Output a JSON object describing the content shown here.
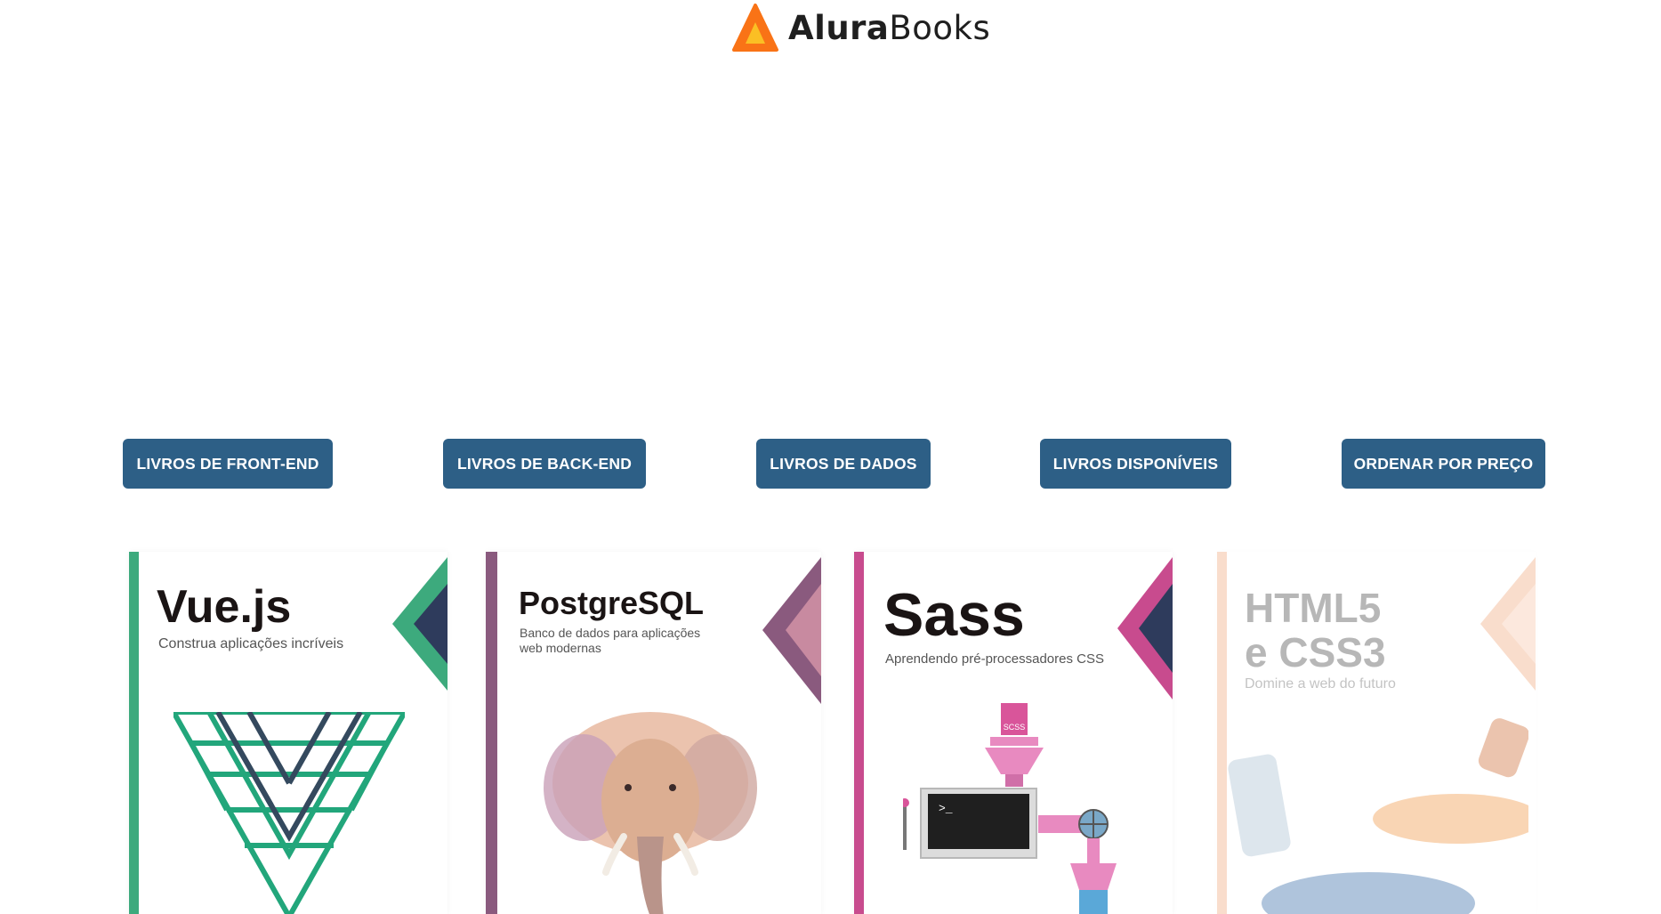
{
  "header": {
    "logo_bold": "Alura",
    "logo_regular": "Books",
    "logo_icon": "triangle-logo-icon"
  },
  "filters": [
    {
      "label": "LIVROS DE FRONT-END"
    },
    {
      "label": "LIVROS DE BACK-END"
    },
    {
      "label": "LIVROS DE DADOS"
    },
    {
      "label": "LIVROS DISPONÍVEIS"
    },
    {
      "label": "ORDENAR POR PREÇO"
    }
  ],
  "books": [
    {
      "title": "Vue.js",
      "subtitle": "Construa aplicações incríveis",
      "accent": "#3daa7d",
      "icon": "vue-logo-icon"
    },
    {
      "title": "PostgreSQL",
      "subtitle_line1": "Banco de dados para aplicações",
      "subtitle_line2": "web modernas",
      "accent": "#8a5a7e",
      "icon": "elephant-icon"
    },
    {
      "title": "Sass",
      "subtitle": "Aprendendo pré-processadores CSS",
      "accent": "#c84b8e",
      "icon": "sass-machine-icon",
      "file_label": "SCSS",
      "terminal_prompt": ">_"
    },
    {
      "title_line1": "HTML5",
      "title_line2": "e CSS3",
      "subtitle": "Domine a web do futuro",
      "accent": "#f0a070",
      "icon": "paint-bottles-icon"
    }
  ],
  "colors": {
    "button_bg": "#2d5f86",
    "button_text": "#ffffff",
    "logo_orange": "#f97316"
  }
}
